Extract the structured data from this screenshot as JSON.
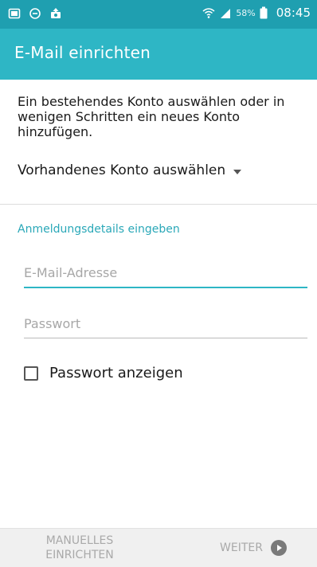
{
  "status_bar": {
    "battery": "58%",
    "time": "08:45",
    "icons": [
      "screenshot-icon",
      "do-not-disturb-icon",
      "upload-icon",
      "wifi-icon",
      "signal-icon",
      "battery-icon"
    ]
  },
  "app_bar": {
    "title": "E-Mail einrichten"
  },
  "intro_text": "Ein bestehendes Konto auswählen oder in wenigen Schritten ein neues Konto hinzufügen.",
  "account_select": {
    "label": "Vorhandenes Konto auswählen"
  },
  "section": {
    "header": "Anmeldungsdetails eingeben"
  },
  "email": {
    "placeholder": "E-Mail-Adresse",
    "value": ""
  },
  "password": {
    "placeholder": "Passwort",
    "value": ""
  },
  "show_password": {
    "label": "Passwort anzeigen",
    "checked": false
  },
  "bottom_bar": {
    "manual_label": "MANUELLES\nEINRICHTEN",
    "next_label": "WEITER"
  },
  "colors": {
    "status_bar": "#1f9fb0",
    "app_bar": "#2eb6c5",
    "accent": "#2aa8b8"
  }
}
